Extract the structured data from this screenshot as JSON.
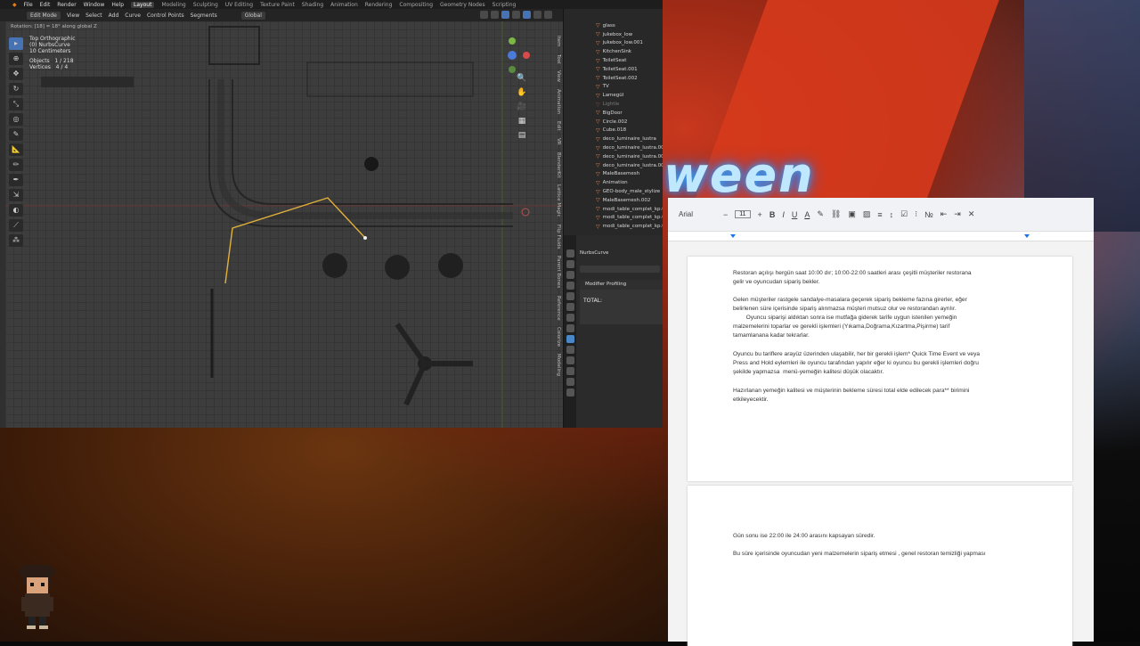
{
  "blender": {
    "menu": [
      "File",
      "Edit",
      "Render",
      "Window",
      "Help"
    ],
    "workspaces": [
      "Layout",
      "Modeling",
      "Sculpting",
      "UV Editing",
      "Texture Paint",
      "Shading",
      "Animation",
      "Rendering",
      "Compositing",
      "Geometry Nodes",
      "Scripting"
    ],
    "active_workspace": "Layout",
    "header": {
      "mode": "Edit Mode",
      "items": [
        "View",
        "Select",
        "Add",
        "Curve",
        "Control Points",
        "Segments"
      ],
      "orientation": "Global"
    },
    "status_line": "Rotation: [18] = 18° along global Z",
    "viewport_info": {
      "view": "Top Orthographic",
      "object": "(0) NurbsCurve",
      "scale": "10 Centimeters",
      "objects_label": "Objects",
      "objects_value": "1 / 218",
      "vertices_label": "Vertices",
      "vertices_value": "4 / 4"
    },
    "side_tabs": [
      "Item",
      "Tool",
      "View",
      "Animation",
      "Edit",
      "VR",
      "BlenderKit",
      "Screencast Keys",
      "Lattice Magic",
      "Flip Fluids",
      "Flip Fluids Tool",
      "FloorGen",
      "Parent Bones",
      "Kits Coloc",
      "Mesh Tools",
      "Reference",
      "Geo Solved",
      "Colorize",
      "Modeling"
    ],
    "outliner": [
      {
        "name": "glass",
        "dim": false
      },
      {
        "name": "jukebox_low",
        "dim": false
      },
      {
        "name": "jukebox_low.001",
        "dim": false
      },
      {
        "name": "KitchenSink",
        "dim": false
      },
      {
        "name": "ToiletSeat",
        "dim": false
      },
      {
        "name": "ToiletSeat.001",
        "dim": false
      },
      {
        "name": "ToiletSeat.002",
        "dim": false
      },
      {
        "name": "TV",
        "dim": false
      },
      {
        "name": "Lamegül",
        "dim": false
      },
      {
        "name": "Lightle",
        "dim": true
      },
      {
        "name": "BigDoor",
        "dim": false
      },
      {
        "name": "Circle.002",
        "dim": false
      },
      {
        "name": "Cube.018",
        "dim": false
      },
      {
        "name": "deco_luminaire_lustra",
        "dim": false
      },
      {
        "name": "deco_luminaire_lustra.002",
        "dim": false
      },
      {
        "name": "deco_luminaire_lustra.003",
        "dim": false
      },
      {
        "name": "deco_luminaire_lustra.004",
        "dim": false
      },
      {
        "name": "MaleBasemesh",
        "dim": false
      },
      {
        "name": "Animation",
        "dim": false
      },
      {
        "name": "GEO-body_male_stylize",
        "dim": false
      },
      {
        "name": "MaleBasemesh.002",
        "dim": false
      },
      {
        "name": "modi_table_complet_kp.00",
        "dim": false
      },
      {
        "name": "modi_table_complet_kp.00",
        "dim": false
      },
      {
        "name": "modi_table_complet_kp.00",
        "dim": false
      }
    ],
    "properties": {
      "object": "NurbsCurve",
      "panel": "Modifier Profiling",
      "total_label": "TOTAL:"
    }
  },
  "docs": {
    "font": "Arial",
    "font_size": "11",
    "paragraphs_page1": [
      [
        "Restoran açılışı hergün saat 10:00 dır; 10:00-22:00 saatleri arası çeşitli müşteriler restorana",
        "gelir ve oyuncudan sipariş bekler."
      ],
      [
        "Gelen müşteriler rastgele sandalye-masalara geçerek sipariş bekleme fazına girerler, eğer",
        "belirlenen süre içerisinde sipariş alınmazsa müşteri mutsuz olur ve restorandan ayrılır.",
        "        Oyuncu siparişi aldıktan sonra ise mutfağa giderek tarife uygun istenilen yemeğin",
        "malzemelerini toparlar ve gerekli işlemleri (Yıkama,Doğrama,Kızartma,Pişirme) tarif",
        "tamamlanana kadar tekrarlar."
      ],
      [
        "Oyuncu bu tariflere arayüz üzerinden ulaşabilir, her bir gerekli işlem* Quick Time Event ve veya",
        "Press and Hold eylemleri ile oyuncu tarafından yapılır eğer ki oyuncu bu gerekli işlemleri doğru",
        "şekilde yapmazsa  menü-yemeğin kalitesi düşük olacaktır."
      ],
      [
        "Hazırlanan yemeğin kalitesi ve müşterinin bekleme süresi total elde edilecek para** birimini",
        "etkileyecektir."
      ]
    ],
    "paragraphs_page2": [
      "Gün sonu ise 22:00 ile 24:00 arasını kapsayan süredir.",
      "Bu süre içerisinde oyuncudan yeni malzemelerin sipariş etmesi , genel restoran temizliği yapması"
    ]
  },
  "background": {
    "sign_text": "ween",
    "accent": "#d63a1c",
    "neon_color": "#bfe8ff"
  }
}
